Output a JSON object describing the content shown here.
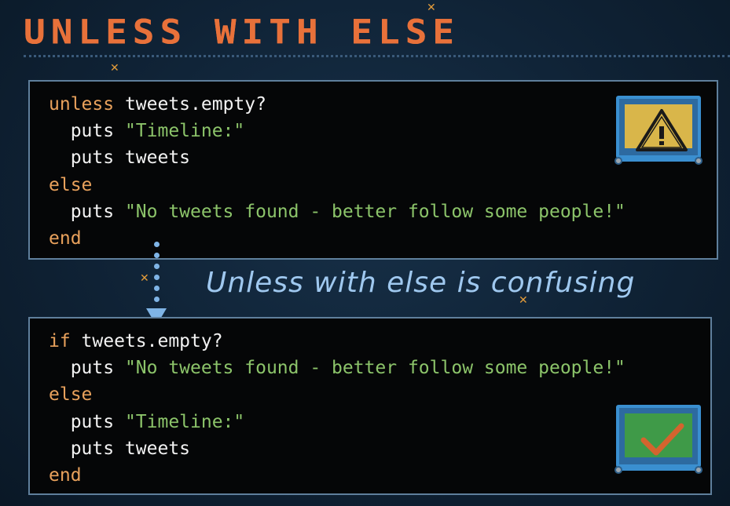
{
  "slide": {
    "title": "UNLESS WITH ELSE",
    "caption": "Unless with else is confusing"
  },
  "code_unless": [
    [
      {
        "t": "kw",
        "v": "unless"
      },
      {
        "t": "plain",
        "v": " tweets.empty?"
      }
    ],
    [
      {
        "t": "plain",
        "v": "  puts "
      },
      {
        "t": "str",
        "v": "\"Timeline:\""
      }
    ],
    [
      {
        "t": "plain",
        "v": "  puts tweets"
      }
    ],
    [
      {
        "t": "kw",
        "v": "else"
      }
    ],
    [
      {
        "t": "plain",
        "v": "  puts "
      },
      {
        "t": "str",
        "v": "\"No tweets found - better follow some people!\""
      }
    ],
    [
      {
        "t": "kw",
        "v": "end"
      }
    ]
  ],
  "code_if": [
    [
      {
        "t": "kw",
        "v": "if"
      },
      {
        "t": "plain",
        "v": " tweets.empty?"
      }
    ],
    [
      {
        "t": "plain",
        "v": "  puts "
      },
      {
        "t": "str",
        "v": "\"No tweets found - better follow some people!\""
      }
    ],
    [
      {
        "t": "kw",
        "v": "else"
      }
    ],
    [
      {
        "t": "plain",
        "v": "  puts "
      },
      {
        "t": "str",
        "v": "\"Timeline:\""
      }
    ],
    [
      {
        "t": "plain",
        "v": "  puts tweets"
      }
    ],
    [
      {
        "t": "kw",
        "v": "end"
      }
    ]
  ],
  "icons": {
    "warning": "warning-monitor-icon",
    "check": "checkmark-monitor-icon"
  },
  "colors": {
    "title": "#e8713a",
    "keyword": "#e8a15c",
    "string": "#8cc46a",
    "caption": "#9fc8ef"
  }
}
